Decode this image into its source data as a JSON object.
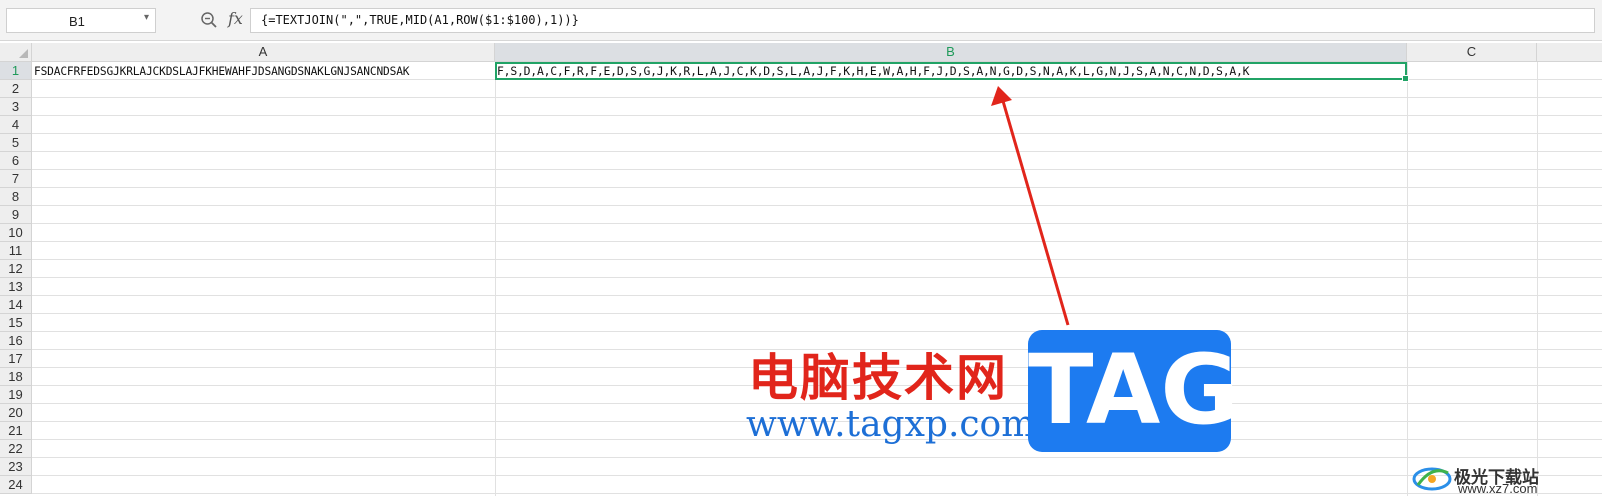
{
  "formula_bar": {
    "name_box": "B1",
    "fx_label": "fx",
    "formula": "{=TEXTJOIN(\",\",TRUE,MID(A1,ROW($1:$100),1))}"
  },
  "columns": [
    {
      "label": "A"
    },
    {
      "label": "B"
    },
    {
      "label": "C"
    }
  ],
  "rows": [
    "1",
    "2",
    "3",
    "4",
    "5",
    "6",
    "7",
    "8",
    "9",
    "10",
    "11",
    "12",
    "13",
    "14",
    "15",
    "16",
    "17",
    "18",
    "19",
    "20",
    "21",
    "22",
    "23",
    "24"
  ],
  "selected_cell": "B1",
  "cells": {
    "A1": "FSDACFRFEDSGJKRLAJCKDSLAJFKHEWAHFJDSANGDSNAKLGNJSANCNDSAK",
    "B1": "F,S,D,A,C,F,R,F,E,D,S,G,J,K,R,L,A,J,C,K,D,S,L,A,J,F,K,H,E,W,A,H,F,J,D,S,A,N,G,D,S,N,A,K,L,G,N,J,S,A,N,C,N,D,S,A,K"
  },
  "colors": {
    "selection": "#21a366",
    "arrow": "#e1251b",
    "watermark_red": "#e1251b",
    "watermark_blue": "#1d7bf0"
  },
  "watermark": {
    "site_name": "电脑技术网",
    "site_url": "www.tagxp.com",
    "tag": "TAG",
    "badge_name": "极光下载站",
    "badge_url": "www.xz7.com"
  }
}
